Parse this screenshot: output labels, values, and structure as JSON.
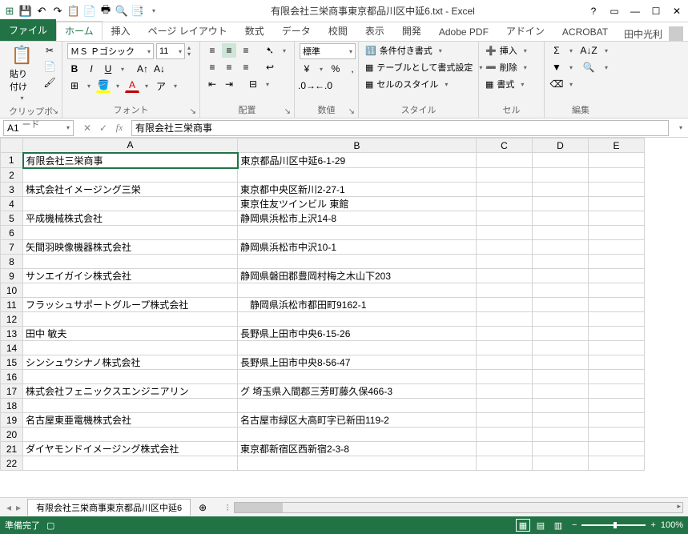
{
  "app_title": "有限会社三栄商事東京都品川区中延6.txt - Excel",
  "user_name": "田中光利",
  "tabs": {
    "file": "ファイル",
    "home": "ホーム",
    "insert": "挿入",
    "pagelayout": "ページ レイアウト",
    "formulas": "数式",
    "data": "データ",
    "review": "校閲",
    "view": "表示",
    "developer": "開発",
    "adobepdf": "Adobe PDF",
    "addin": "アドイン",
    "acrobat": "ACROBAT"
  },
  "ribbon": {
    "clipboard": {
      "label": "クリップボード",
      "paste": "貼り付け"
    },
    "font": {
      "label": "フォント",
      "name": "ＭＳ Ｐゴシック",
      "size": "11"
    },
    "align": {
      "label": "配置"
    },
    "number": {
      "label": "数値",
      "format": "標準"
    },
    "style": {
      "label": "スタイル",
      "cond": "条件付き書式",
      "tablefmt": "テーブルとして書式設定",
      "cellstyle": "セルのスタイル"
    },
    "cells": {
      "label": "セル",
      "insert": "挿入",
      "delete": "削除",
      "format": "書式"
    },
    "editing": {
      "label": "編集"
    }
  },
  "namebox": "A1",
  "formula": "有限会社三栄商事",
  "columns": [
    "A",
    "B",
    "C",
    "D",
    "E"
  ],
  "rows": [
    {
      "n": 1,
      "a": "有限会社三栄商事",
      "b": "東京都品川区中延6-1-29"
    },
    {
      "n": 2,
      "a": "",
      "b": ""
    },
    {
      "n": 3,
      "a": "株式会社イメージング三栄",
      "b": "東京都中央区新川2-27-1"
    },
    {
      "n": 4,
      "a": "",
      "b": "東京住友ツインビル 東館"
    },
    {
      "n": 5,
      "a": "平成機械株式会社",
      "b": "静岡県浜松市上沢14-8"
    },
    {
      "n": 6,
      "a": "",
      "b": ""
    },
    {
      "n": 7,
      "a": "矢間羽映像機器株式会社",
      "b": "静岡県浜松市中沢10-1"
    },
    {
      "n": 8,
      "a": "",
      "b": ""
    },
    {
      "n": 9,
      "a": "サンエイガイシ株式会社",
      "b": "静岡県磐田郡豊岡村梅之木山下203"
    },
    {
      "n": 10,
      "a": "",
      "b": ""
    },
    {
      "n": 11,
      "a": "フラッシュサポートグループ株式会社",
      "b": "　静岡県浜松市都田町9162-1"
    },
    {
      "n": 12,
      "a": "",
      "b": ""
    },
    {
      "n": 13,
      "a": "田中  敏夫",
      "b": "長野県上田市中央6-15-26"
    },
    {
      "n": 14,
      "a": "",
      "b": ""
    },
    {
      "n": 15,
      "a": "シンシュウシナノ株式会社",
      "b": "長野県上田市中央8-56-47"
    },
    {
      "n": 16,
      "a": "",
      "b": ""
    },
    {
      "n": 17,
      "a": "株式会社フェニックスエンジニアリン",
      "b": "グ  埼玉県入間郡三芳町藤久保466-3"
    },
    {
      "n": 18,
      "a": "",
      "b": ""
    },
    {
      "n": 19,
      "a": "名古屋東亜電機株式会社",
      "b": "名古屋市緑区大高町字已新田119-2"
    },
    {
      "n": 20,
      "a": "",
      "b": ""
    },
    {
      "n": 21,
      "a": "ダイヤモンドイメージング株式会社",
      "b": "東京都新宿区西新宿2-3-8"
    },
    {
      "n": 22,
      "a": "",
      "b": ""
    }
  ],
  "sheet_tab": "有限会社三栄商事東京都品川区中延6",
  "status": {
    "ready": "準備完了",
    "zoom": "100%"
  }
}
